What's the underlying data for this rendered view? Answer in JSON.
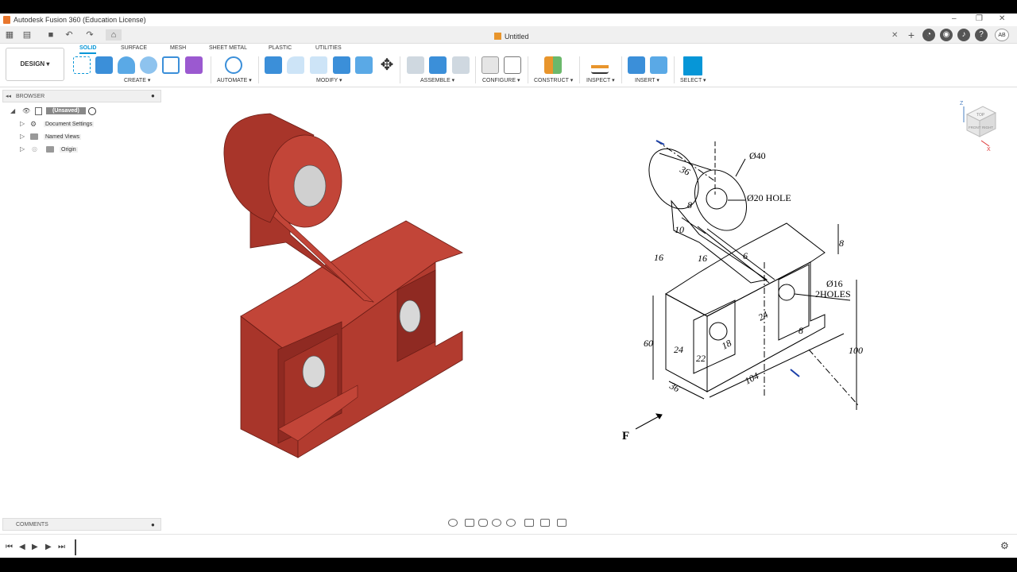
{
  "window": {
    "title": "Autodesk Fusion 360 (Education License)"
  },
  "document": {
    "name": "Untitled"
  },
  "user": {
    "initials": "AB"
  },
  "workspace": {
    "label": "DESIGN ▾"
  },
  "ribbon": {
    "tabs": [
      "SOLID",
      "SURFACE",
      "MESH",
      "SHEET METAL",
      "PLASTIC",
      "UTILITIES"
    ],
    "groups": {
      "create": "CREATE ▾",
      "automate": "AUTOMATE ▾",
      "modify": "MODIFY ▾",
      "assemble": "ASSEMBLE ▾",
      "configure": "CONFIGURE ▾",
      "construct": "CONSTRUCT ▾",
      "inspect": "INSPECT ▾",
      "insert": "INSERT ▾",
      "select": "SELECT ▾"
    }
  },
  "browser": {
    "header": "BROWSER",
    "root": "(Unsaved)",
    "items": [
      "Document Settings",
      "Named Views",
      "Origin"
    ]
  },
  "comments": {
    "header": "COMMENTS"
  },
  "drawing": {
    "dims": {
      "d40": "Ø40",
      "d20": "Ø20 HOLE",
      "d16": "Ø16",
      "holes": "2HOLES",
      "v36a": "36",
      "v8a": "8",
      "v10": "10",
      "v16": "16",
      "v16b": "16",
      "v8b": "8",
      "v6": "6",
      "v60": "60",
      "v24a": "24",
      "v24b": "24",
      "v22": "22",
      "v18": "18",
      "v36b": "36",
      "v104": "104",
      "v100": "100",
      "v8c": "8",
      "f": "F"
    }
  },
  "viewcube": {
    "top": "TOP",
    "front": "FRONT",
    "right": "RIGHT",
    "z": "Z",
    "x": "X"
  },
  "colors": {
    "model": "#b33a2e",
    "accent": "#0696d7"
  }
}
